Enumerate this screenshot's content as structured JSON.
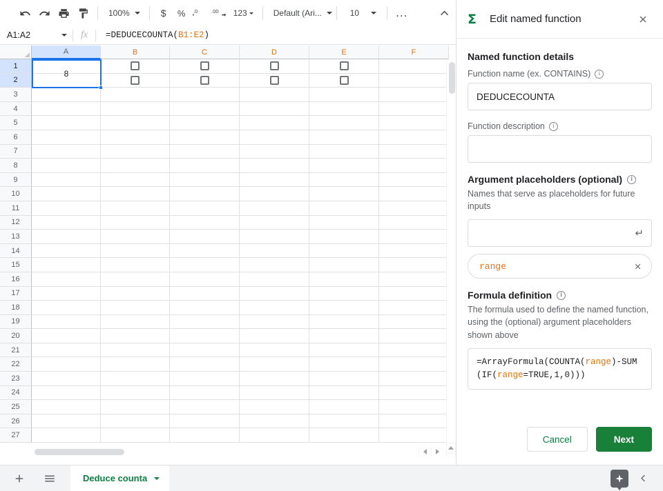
{
  "toolbar": {
    "undo_label": "Undo",
    "redo_label": "Redo",
    "print_label": "Print",
    "paint_format_label": "Paint format",
    "zoom_value": "100%",
    "currency_label": "$",
    "percent_label": "%",
    "decrease_decimal_label": ".0",
    "increase_decimal_label": ".00",
    "more_formats_label": "123",
    "font_value": "Default (Ari...",
    "font_size_value": "10",
    "more_label": "...",
    "collapse_toolbar_label": "^"
  },
  "formula_bar": {
    "name_box_value": "A1:A2",
    "fx_label": "fx",
    "formula_prefix": "=DEDUCECOUNTA(",
    "formula_ref": "B1:E2",
    "formula_suffix": ")"
  },
  "grid": {
    "columns": [
      "A",
      "B",
      "C",
      "D",
      "E",
      "F"
    ],
    "selected_column": "A",
    "highlighted_columns": [
      "B",
      "C",
      "D",
      "E",
      "F"
    ],
    "rows": [
      1,
      2,
      3,
      4,
      5,
      6,
      7,
      8,
      9,
      10,
      11,
      12,
      13,
      14,
      15,
      16,
      17,
      18,
      19,
      20,
      21,
      22,
      23,
      24,
      25,
      26,
      27
    ],
    "selected_rows": [
      1,
      2
    ],
    "merged_cell_value": "8",
    "merged_cell_range": "A1:A2",
    "checkbox_cells": [
      "B1",
      "C1",
      "D1",
      "E1",
      "B2",
      "C2",
      "D2",
      "E2"
    ],
    "checkbox_checked": false
  },
  "bottom_bar": {
    "add_sheet_label": "+",
    "all_sheets_label": "All sheets",
    "sheet_tab_name": "Deduce counta",
    "explore_label": "Explore",
    "collapse_label": "Hide"
  },
  "panel": {
    "title": "Edit named function",
    "sigma_icon": "Σ",
    "close_label": "✕",
    "section_details_title": "Named function details",
    "function_name_label": "Function name (ex. CONTAINS)",
    "function_name_value": "DEDUCECOUNTA",
    "function_description_label": "Function description",
    "function_description_value": "",
    "function_description_placeholder": "",
    "arg_placeholders_title": "Argument placeholders (optional)",
    "arg_placeholders_helper": "Names that serve as placeholders for future inputs",
    "arg_input_value": "",
    "arg_input_placeholder": "",
    "arg_enter_glyph": "↵",
    "arg_chips": [
      {
        "label": "range",
        "remove_label": "✕"
      }
    ],
    "formula_definition_title": "Formula definition",
    "formula_definition_helper": "The formula used to define the named function, using the (optional) argument placeholders shown above",
    "formula_parts": [
      {
        "text": "=ArrayFormula(COUNTA(",
        "highlight": false
      },
      {
        "text": "range",
        "highlight": true
      },
      {
        "text": ")-SUM(IF(",
        "highlight": false
      },
      {
        "text": "range",
        "highlight": true
      },
      {
        "text": "=TRUE,1,0)))",
        "highlight": false
      }
    ],
    "formula_definition_value": "=ArrayFormula(COUNTA(range)-SUM(IF(range=TRUE,1,0)))",
    "cancel_label": "Cancel",
    "next_label": "Next",
    "info_glyph": "i"
  },
  "colors": {
    "accent_green": "#188038",
    "link_green": "#0b8043",
    "reference_orange": "#e8710a",
    "selection_blue": "#1a73e8",
    "header_bg": "#f8f9fa"
  }
}
